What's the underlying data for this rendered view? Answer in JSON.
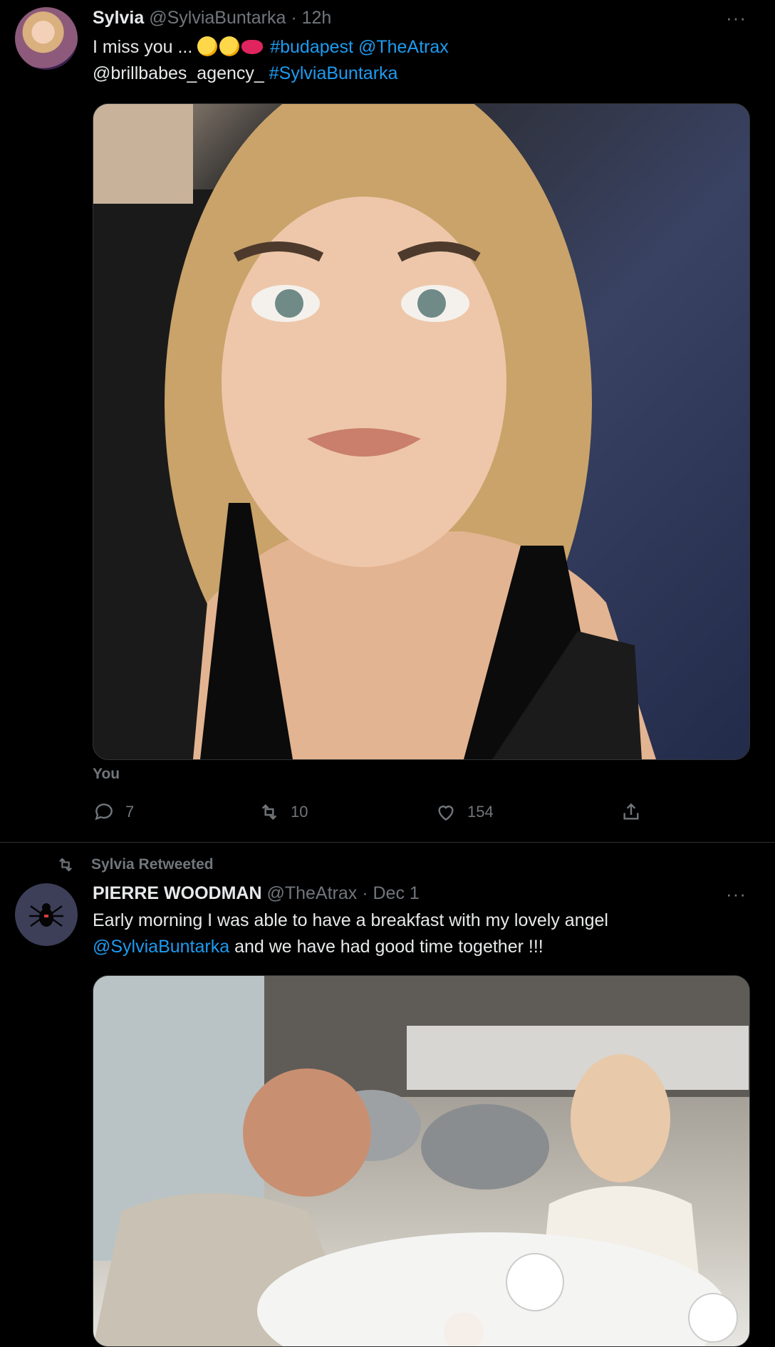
{
  "tweet1": {
    "name": "Sylvia",
    "handle": "@SylviaBuntarka",
    "dot": "·",
    "time": "12h",
    "text_lead": "I miss you ...",
    "hashtag1": "#budapest",
    "mention1": "@TheAtrax",
    "text_mention_plain": "@brillbabes_agency_",
    "hashtag2": "#SylviaBuntarka",
    "media_caption": "You",
    "replies": "7",
    "retweets": "10",
    "likes": "154",
    "more": "···"
  },
  "tweet2": {
    "retweet_banner": "Sylvia Retweeted",
    "name": "PIERRE WOODMAN",
    "handle": "@TheAtrax",
    "dot": "·",
    "time": "Dec 1",
    "text_part1": "Early morning I was able to have a breakfast with my lovely angel",
    "mention": "@SylviaBuntarka",
    "text_part2": "and we have had good time together !!!",
    "more": "···"
  },
  "colors": {
    "background": "#000000",
    "text": "#e7e9ea",
    "secondary": "#71767b",
    "link": "#1d9bf0",
    "divider": "#2f3336"
  },
  "icons": [
    "reply-icon",
    "retweet-icon",
    "like-icon",
    "share-icon",
    "more-icon",
    "spider-avatar-icon"
  ]
}
